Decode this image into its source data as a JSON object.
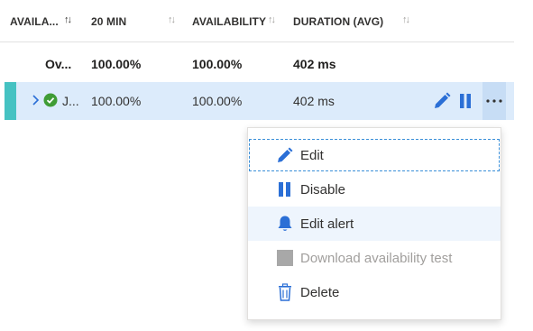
{
  "header": {
    "col1": "AVAILA...",
    "col2": "20 MIN",
    "col3": "AVAILABILITY",
    "col4": "DURATION (AVG)"
  },
  "summary": {
    "name": "Ov...",
    "twenty_min": "100.00%",
    "availability": "100.00%",
    "duration": "402 ms"
  },
  "row": {
    "name": "J...",
    "twenty_min": "100.00%",
    "availability": "100.00%",
    "duration": "402 ms",
    "status_icon": "check-circle-icon",
    "actions": [
      "edit-pencil-icon",
      "pause-icon",
      "more-options-icon"
    ]
  },
  "menu": {
    "items": [
      {
        "label": "Edit",
        "icon": "pencil-icon",
        "state": "focused"
      },
      {
        "label": "Disable",
        "icon": "pause-icon",
        "state": "normal"
      },
      {
        "label": "Edit alert",
        "icon": "bell-icon",
        "state": "hover"
      },
      {
        "label": "Download availability test",
        "icon": "download-icon",
        "state": "disabled"
      },
      {
        "label": "Delete",
        "icon": "trash-icon",
        "state": "normal"
      }
    ]
  },
  "colors": {
    "accent": "#2b6fd6",
    "row_selected": "#dcebfb",
    "status_bar": "#45c2c2",
    "success": "#3f9c35"
  }
}
